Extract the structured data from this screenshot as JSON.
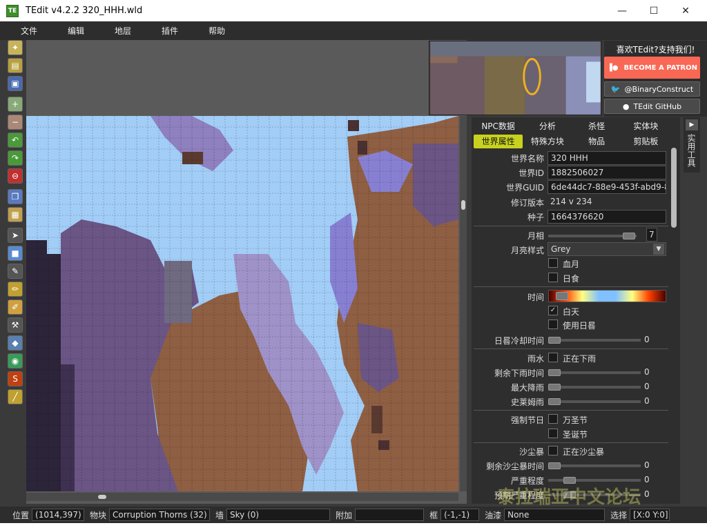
{
  "window": {
    "title": "TEdit v4.2.2 320_HHH.wld",
    "app_icon": "TE"
  },
  "menu": [
    "文件",
    "编辑",
    "地层",
    "插件",
    "帮助"
  ],
  "support": {
    "title": "喜欢TEdit?支持我们!",
    "patron": "BECOME A PATRON",
    "twitter": "@BinaryConstruct",
    "github": "TEdit GitHub"
  },
  "tabs": {
    "row1": [
      "NPC数据",
      "分析",
      "杀怪",
      "实体块"
    ],
    "row2": [
      "世界属性",
      "特殊方块",
      "物品",
      "剪贴板"
    ],
    "active": "世界属性"
  },
  "props": {
    "world_name_label": "世界名称",
    "world_name": "320 HHH",
    "world_id_label": "世界ID",
    "world_id": "1882506027",
    "world_guid_label": "世界GUID",
    "world_guid": "6de44dc7-88e9-453f-abd9-8",
    "revision_label": "修订版本",
    "revision": "214    v 234",
    "seed_label": "种子",
    "seed": "1664376620",
    "moon_phase_label": "月相",
    "moon_phase": "7",
    "moon_style_label": "月亮样式",
    "moon_style": "Grey",
    "blood_moon": "血月",
    "eclipse": "日食",
    "time_label": "时间",
    "daytime": "白天",
    "sundial": "使用日晷",
    "sundial_cooldown_label": "日晷冷却时间",
    "sundial_cooldown": "0",
    "rain_label": "雨水",
    "raining": "正在下雨",
    "rain_time_label": "剩余下雨时间",
    "rain_time": "0",
    "max_rain_label": "最大降雨",
    "max_rain": "0",
    "slime_rain_label": "史莱姆雨",
    "slime_rain": "0",
    "force_holiday_label": "强制节日",
    "halloween": "万圣节",
    "christmas": "圣诞节",
    "sandstorm_label": "沙尘暴",
    "sandstorm_active": "正在沙尘暴",
    "sandstorm_time_label": "剩余沙尘暴时间",
    "sandstorm_time": "0",
    "severity_label": "严重程度",
    "severity": "0",
    "expected_severity_label": "预期严重程度",
    "expected_severity": "0"
  },
  "side_tab": "实用工具",
  "status": {
    "pos_label": "位置",
    "pos": "(1014,397)",
    "tile_label": "物块",
    "tile": "Corruption Thorns (32)",
    "wall_label": "墙",
    "wall": "Sky (0)",
    "extra_label": "附加",
    "extra": "",
    "frame_label": "框",
    "frame": "(-1,-1)",
    "paint_label": "油漆",
    "paint": "None",
    "select_label": "选择",
    "select": "[X:0 Y:0]"
  },
  "watermark": "泰拉瑞亚中文论坛",
  "colors": {
    "sky": "#a2cdf6",
    "corruption": "#6a5585",
    "dirt": "#8f5f43",
    "ebonstone": "#2c2438",
    "vine": "#8780d2"
  }
}
